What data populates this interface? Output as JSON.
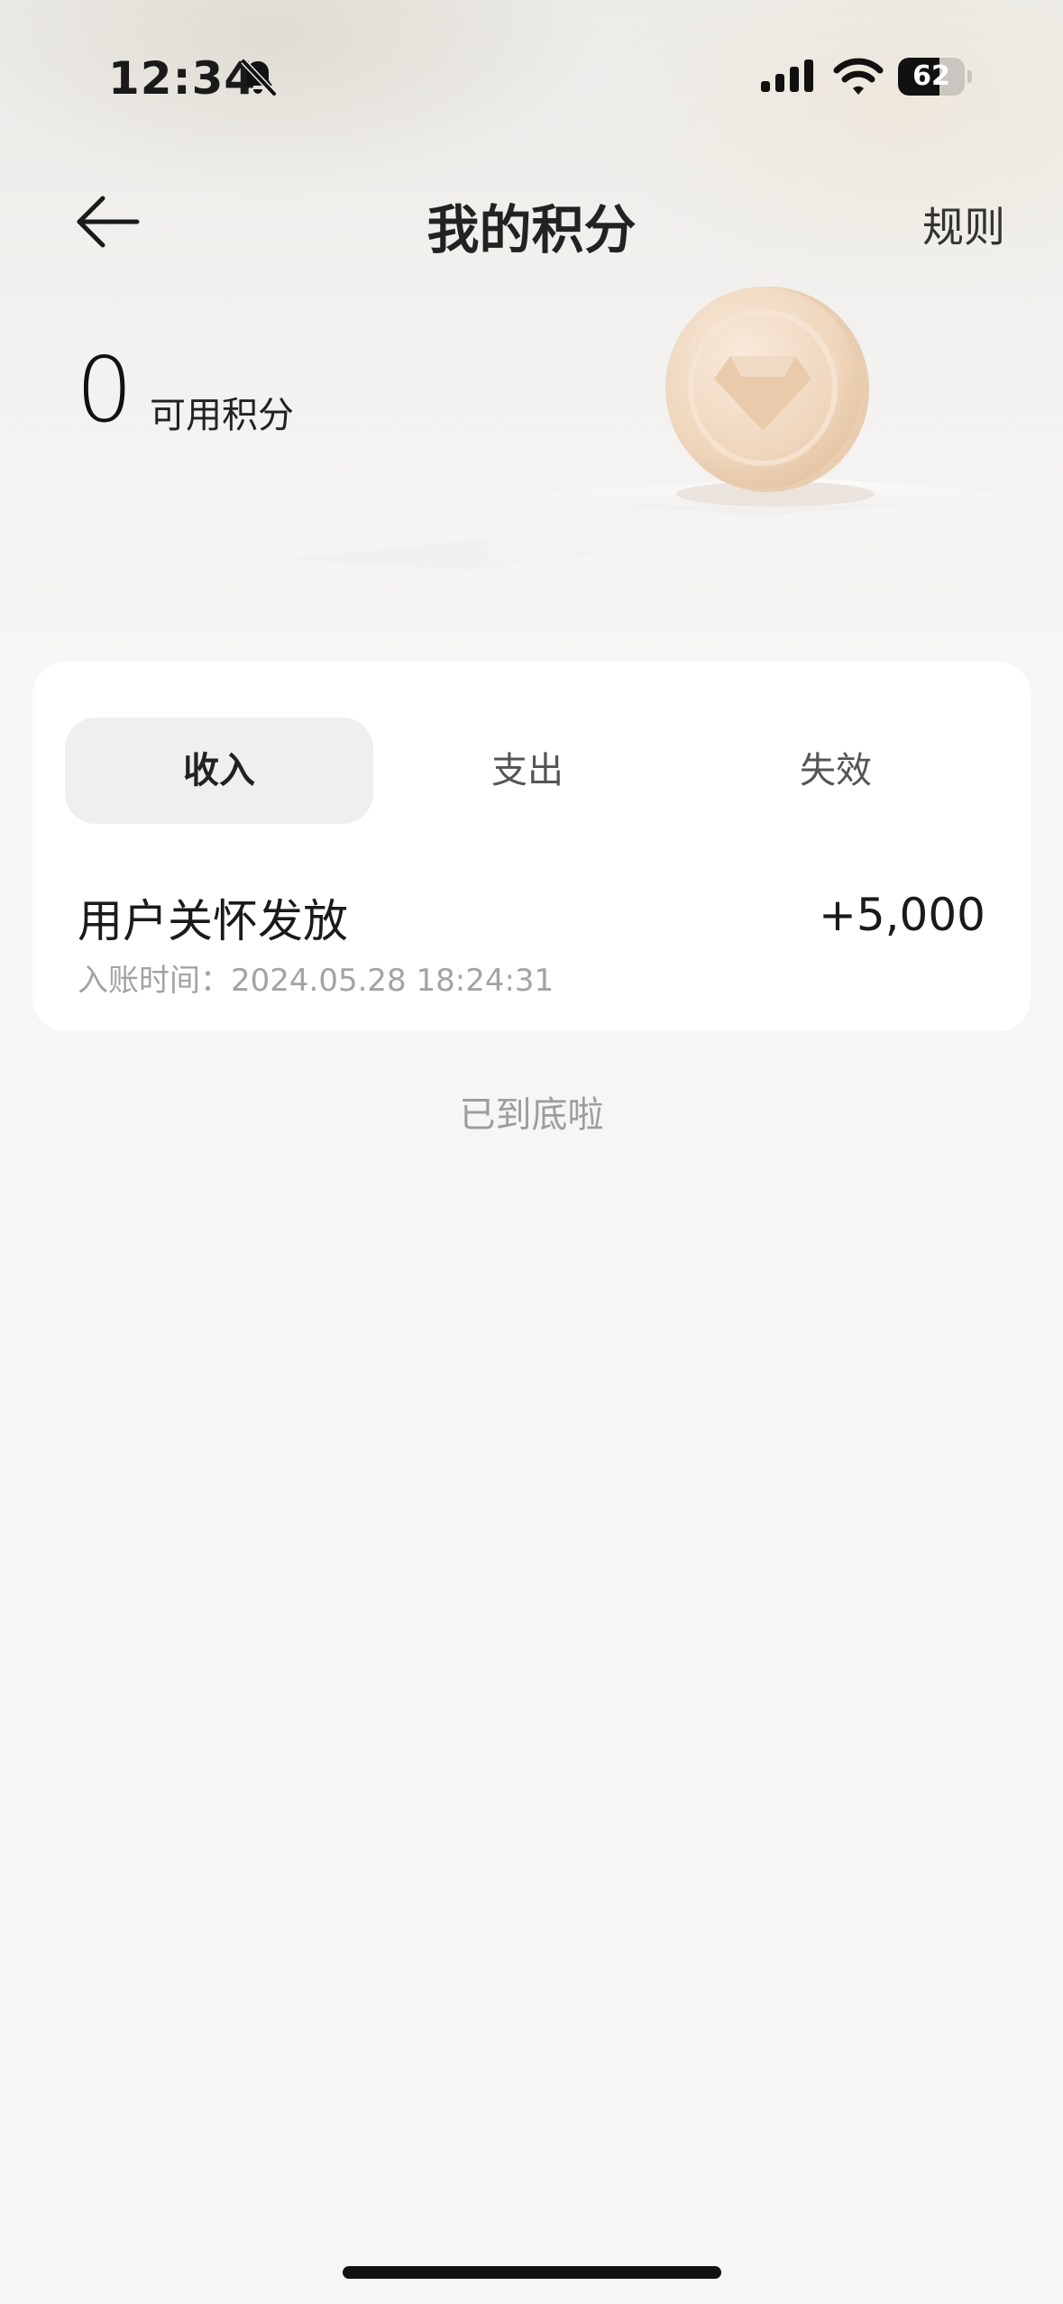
{
  "status_bar": {
    "time": "12:34",
    "battery_percent": "62",
    "battery_level": 0.62,
    "icons": [
      "bell-slash-icon",
      "signal-icon",
      "wifi-icon",
      "battery-icon"
    ]
  },
  "header": {
    "title": "我的积分",
    "rules_label": "规则",
    "back_icon": "arrow-left-icon"
  },
  "points": {
    "value": "0",
    "label": "可用积分"
  },
  "tabs": [
    {
      "label": "收入",
      "active": true
    },
    {
      "label": "支出",
      "active": false
    },
    {
      "label": "失效",
      "active": false
    }
  ],
  "records": [
    {
      "title": "用户关怀发放",
      "amount": "+5,000",
      "time_label": "入账时间：",
      "time_value": "2024.05.28 18:24:31"
    }
  ],
  "end_note": "已到底啦",
  "colors": {
    "page_bg": "#f6f6f6",
    "card_bg": "#ffffff",
    "active_tab_bg": "#efefef",
    "coin": "#f1dcc4"
  }
}
